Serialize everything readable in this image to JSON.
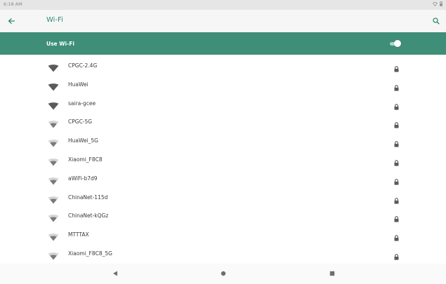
{
  "status": {
    "time": "6:18 AM"
  },
  "app_bar": {
    "title": "Wi-Fi",
    "back_icon": "arrow-left-icon",
    "search_icon": "search-icon"
  },
  "master": {
    "label": "Use Wi-Fi",
    "enabled": true
  },
  "networks": [
    {
      "ssid": "CPGC-2.4G",
      "signal": "strong",
      "secured": true
    },
    {
      "ssid": "HuaWei",
      "signal": "strong",
      "secured": true
    },
    {
      "ssid": "saira-gcee",
      "signal": "strong",
      "secured": true
    },
    {
      "ssid": "CPGC-5G",
      "signal": "medium",
      "secured": true
    },
    {
      "ssid": "HuaWei_5G",
      "signal": "medium",
      "secured": true
    },
    {
      "ssid": "Xiaomi_F8C8",
      "signal": "medium",
      "secured": true
    },
    {
      "ssid": "aWiFi-b7d9",
      "signal": "medium",
      "secured": true
    },
    {
      "ssid": "ChinaNet-115d",
      "signal": "medium",
      "secured": true
    },
    {
      "ssid": "ChinaNet-kQGz",
      "signal": "medium",
      "secured": true
    },
    {
      "ssid": "MTTTAX",
      "signal": "medium",
      "secured": true
    },
    {
      "ssid": "Xiaomi_F8C8_5G",
      "signal": "medium",
      "secured": true
    }
  ],
  "colors": {
    "accent": "#3e8e78",
    "title": "#2e8a72",
    "icon": "#5a5a5a"
  }
}
